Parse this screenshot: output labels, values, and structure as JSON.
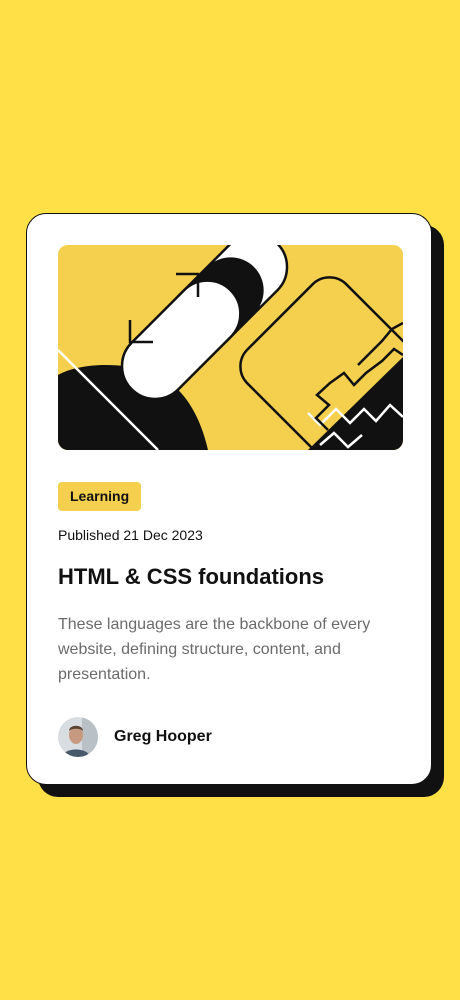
{
  "card": {
    "badge": "Learning",
    "published": "Published 21 Dec 2023",
    "title": "HTML & CSS foundations",
    "description": "These languages are the backbone of every website, defining structure, content, and presentation.",
    "author_name": "Greg Hooper"
  },
  "colors": {
    "background": "#FFE047",
    "accent": "#F4D04E",
    "ink": "#111111",
    "body_text": "#6B6B6B",
    "card": "#FFFFFF"
  },
  "icons": {
    "illustration": "abstract-shapes-illustration",
    "avatar": "author-avatar-photo"
  }
}
